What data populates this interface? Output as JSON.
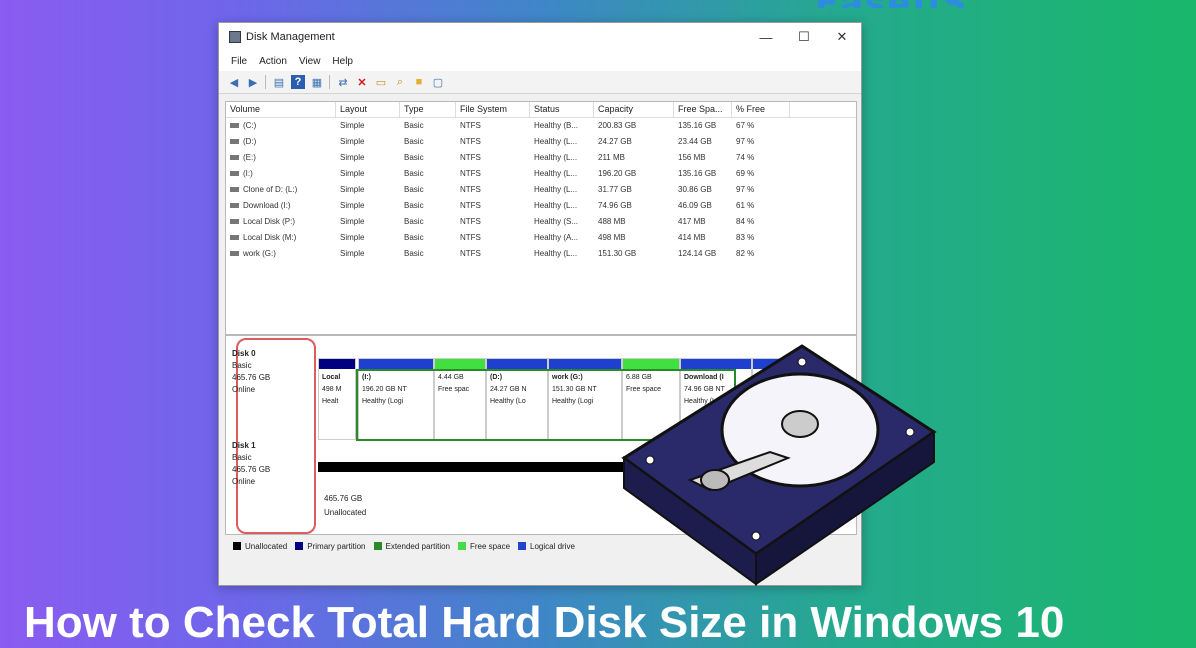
{
  "brand": {
    "text": "EaseUS"
  },
  "window": {
    "title": "Disk Management",
    "controls": {
      "minimize": "—",
      "maximize": "☐",
      "close": "✕"
    }
  },
  "menu": [
    "File",
    "Action",
    "View",
    "Help"
  ],
  "volume_table": {
    "headers": [
      "Volume",
      "Layout",
      "Type",
      "File System",
      "Status",
      "Capacity",
      "Free Spa...",
      "% Free"
    ],
    "rows": [
      [
        "(C:)",
        "Simple",
        "Basic",
        "NTFS",
        "Healthy (B...",
        "200.83 GB",
        "135.16 GB",
        "67 %"
      ],
      [
        "(D:)",
        "Simple",
        "Basic",
        "NTFS",
        "Healthy (L...",
        "24.27 GB",
        "23.44 GB",
        "97 %"
      ],
      [
        "(E:)",
        "Simple",
        "Basic",
        "NTFS",
        "Healthy (L...",
        "211 MB",
        "156 MB",
        "74 %"
      ],
      [
        "(I:)",
        "Simple",
        "Basic",
        "NTFS",
        "Healthy (L...",
        "196.20 GB",
        "135.16 GB",
        "69 %"
      ],
      [
        "Clone of D: (L:)",
        "Simple",
        "Basic",
        "NTFS",
        "Healthy (L...",
        "31.77 GB",
        "30.86 GB",
        "97 %"
      ],
      [
        "Download (I:)",
        "Simple",
        "Basic",
        "NTFS",
        "Healthy (L...",
        "74.96 GB",
        "46.09 GB",
        "61 %"
      ],
      [
        "Local Disk (P:)",
        "Simple",
        "Basic",
        "NTFS",
        "Healthy (S...",
        "488 MB",
        "417 MB",
        "84 %"
      ],
      [
        "Local Disk (M:)",
        "Simple",
        "Basic",
        "NTFS",
        "Healthy (A...",
        "498 MB",
        "414 MB",
        "83 %"
      ],
      [
        "work (G:)",
        "Simple",
        "Basic",
        "NTFS",
        "Healthy (L...",
        "151.30 GB",
        "124.14 GB",
        "82 %"
      ]
    ]
  },
  "disks": [
    {
      "name": "Disk 0",
      "type": "Basic",
      "size": "465.76 GB",
      "status": "Online"
    },
    {
      "name": "Disk 1",
      "type": "Basic",
      "size": "465.76 GB",
      "status": "Online"
    }
  ],
  "disk0_partitions": [
    {
      "name": "Local",
      "size": "498 M",
      "status": "Healt"
    },
    {
      "name": "(I:)",
      "size": "196.20 GB NT",
      "status": "Healthy (Logi"
    },
    {
      "name": "",
      "size": "4.44 GB",
      "status": "Free spac"
    },
    {
      "name": "(D:)",
      "size": "24.27 GB N",
      "status": "Healthy (Lo"
    },
    {
      "name": "work (G:)",
      "size": "151.30 GB NT",
      "status": "Healthy (Logi"
    },
    {
      "name": "",
      "size": "6.88 GB",
      "status": "Free space"
    },
    {
      "name": "Download (I",
      "size": "74.96 GB NT",
      "status": "Healthy (Lo"
    }
  ],
  "disk1_unallocated": {
    "size": "465.76 GB",
    "label": "Unallocated"
  },
  "legend": [
    {
      "label": "Unallocated",
      "color": "#000000"
    },
    {
      "label": "Primary partition",
      "color": "#000080"
    },
    {
      "label": "Extended partition",
      "color": "#2a8a2a"
    },
    {
      "label": "Free space",
      "color": "#44dd44"
    },
    {
      "label": "Logical drive",
      "color": "#2244cc"
    }
  ],
  "colors": {
    "logical": "#1f3fd0",
    "free": "#3fe03f",
    "primary": "#000080",
    "unallocated": "#000000"
  },
  "headline": "How to Check Total Hard Disk Size in Windows 10"
}
